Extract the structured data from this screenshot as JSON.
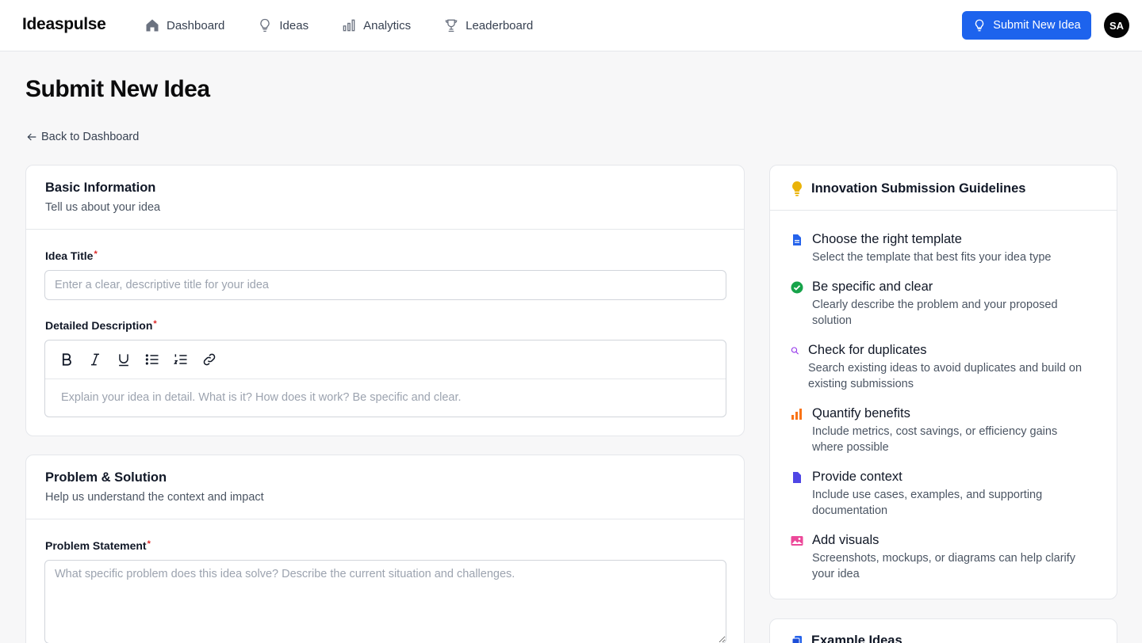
{
  "nav": {
    "brand": "Ideaspulse",
    "links": [
      {
        "label": "Dashboard",
        "icon": "home-icon"
      },
      {
        "label": "Ideas",
        "icon": "lightbulb-icon"
      },
      {
        "label": "Analytics",
        "icon": "bar-chart-icon"
      },
      {
        "label": "Leaderboard",
        "icon": "trophy-icon"
      }
    ],
    "submit_label": "Submit New Idea",
    "avatar_initials": "SA"
  },
  "page": {
    "title": "Submit New Idea",
    "back_label": "Back to Dashboard"
  },
  "basic_info": {
    "title": "Basic Information",
    "subtitle": "Tell us about your idea",
    "idea_title_label": "Idea Title",
    "idea_title_placeholder": "Enter a clear, descriptive title for your idea",
    "idea_title_value": "",
    "description_label": "Detailed Description",
    "description_placeholder": "Explain your idea in detail. What is it? How does it work? Be specific and clear.",
    "required_mark": "*"
  },
  "problem_solution": {
    "title": "Problem & Solution",
    "subtitle": "Help us understand the context and impact",
    "problem_label": "Problem Statement",
    "problem_placeholder": "What specific problem does this idea solve? Describe the current situation and challenges."
  },
  "guidelines": {
    "title": "Innovation Submission Guidelines",
    "items": [
      {
        "title": "Choose the right template",
        "desc": "Select the template that best fits your idea type",
        "icon": "document-icon",
        "color": "#2563eb"
      },
      {
        "title": "Be specific and clear",
        "desc": "Clearly describe the problem and your proposed solution",
        "icon": "check-circle-icon",
        "color": "#16a34a"
      },
      {
        "title": "Check for duplicates",
        "desc": "Search existing ideas to avoid duplicates and build on existing submissions",
        "icon": "search-icon",
        "color": "#9333ea"
      },
      {
        "title": "Quantify benefits",
        "desc": "Include metrics, cost savings, or efficiency gains where possible",
        "icon": "bar-chart-icon",
        "color": "#f97316"
      },
      {
        "title": "Provide context",
        "desc": "Include use cases, examples, and supporting documentation",
        "icon": "file-icon",
        "color": "#4f46e5"
      },
      {
        "title": "Add visuals",
        "desc": "Screenshots, mockups, or diagrams can help clarify your idea",
        "icon": "image-icon",
        "color": "#ec4899"
      }
    ]
  },
  "examples": {
    "title": "Example Ideas"
  },
  "colors": {
    "accent": "#1d63ed",
    "bulb": "#eab308"
  }
}
